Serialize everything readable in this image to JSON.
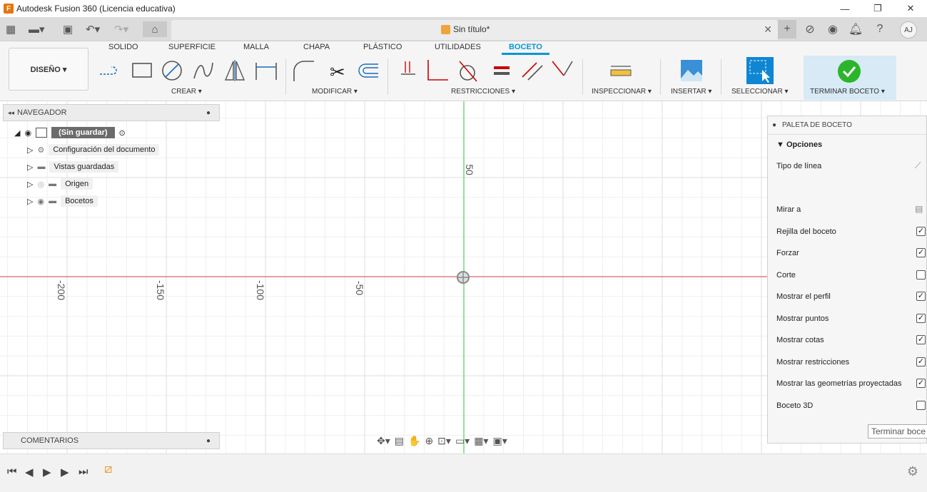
{
  "window": {
    "title": "Autodesk Fusion 360 (Licencia educativa)"
  },
  "document": {
    "tab_name": "Sin título*"
  },
  "user": {
    "initials": "AJ"
  },
  "ribbon": {
    "design_label": "DISEÑO ▾",
    "tabs": [
      "SOLIDO",
      "SUPERFICIE",
      "MALLA",
      "CHAPA",
      "PLÁSTICO",
      "UTILIDADES",
      "BOCETO"
    ],
    "active_tab": "BOCETO",
    "groups": {
      "crear": "CREAR ▾",
      "modificar": "MODIFICAR ▾",
      "restricciones": "RESTRICCIONES ▾",
      "inspeccionar": "INSPECCIONAR ▾",
      "insertar": "INSERTAR ▾",
      "seleccionar": "SELECCIONAR ▾",
      "terminar": "TERMINAR BOCETO ▾"
    }
  },
  "navigator": {
    "title": "NAVEGADOR",
    "root": "(Sin guardar)",
    "items": [
      "Configuración del documento",
      "Vistas guardadas",
      "Origen",
      "Bocetos"
    ]
  },
  "comments": {
    "title": "COMENTARIOS"
  },
  "canvas": {
    "axis_labels": {
      "y_50": "50",
      "x_neg200": "-200",
      "x_neg150": "-150",
      "x_neg100": "-100",
      "x_neg50": "-50"
    }
  },
  "palette": {
    "title": "PALETA DE BOCETO",
    "section": "▼ Opciones",
    "rows": [
      {
        "label": "Tipo de línea",
        "checked": null
      },
      {
        "label": "Mirar a",
        "checked": null
      },
      {
        "label": "Rejilla del boceto",
        "checked": true
      },
      {
        "label": "Forzar",
        "checked": true
      },
      {
        "label": "Corte",
        "checked": false
      },
      {
        "label": "Mostrar el perfil",
        "checked": true
      },
      {
        "label": "Mostrar puntos",
        "checked": true
      },
      {
        "label": "Mostrar cotas",
        "checked": true
      },
      {
        "label": "Mostrar restricciones",
        "checked": true
      },
      {
        "label": "Mostrar las geometrías proyectadas",
        "checked": true
      },
      {
        "label": "Boceto 3D",
        "checked": false
      }
    ],
    "finish_button": "Terminar boce"
  },
  "colors": {
    "accent": "#0696d7",
    "x_axis": "#e06060",
    "y_axis": "#6cd36c",
    "finish_green": "#2bb52b"
  }
}
